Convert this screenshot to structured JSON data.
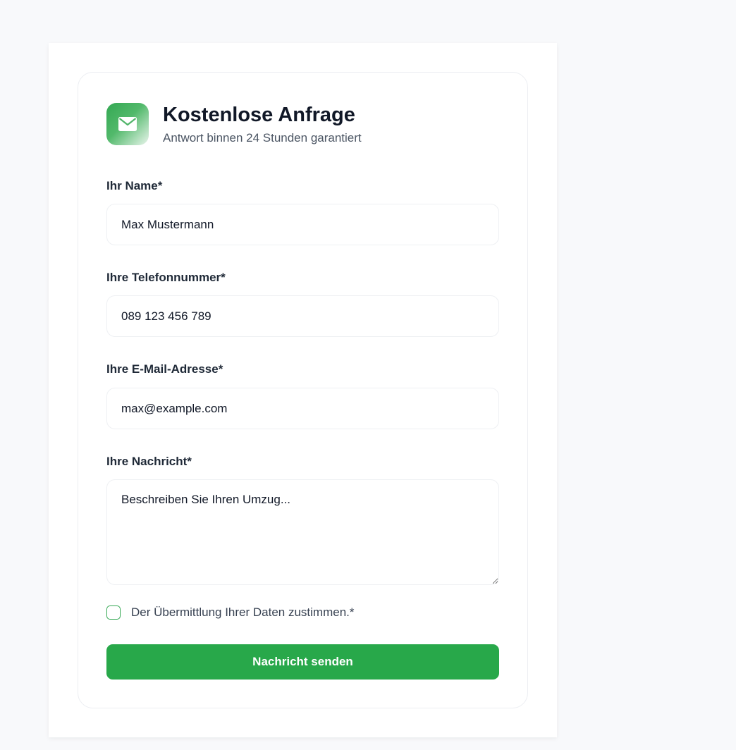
{
  "form": {
    "icon": "mail-icon",
    "title": "Kostenlose Anfrage",
    "subtitle": "Antwort binnen 24 Stunden garantiert",
    "fields": {
      "name": {
        "label": "Ihr Name*",
        "placeholder": "Max Mustermann"
      },
      "phone": {
        "label": "Ihre Telefonnummer*",
        "placeholder": "089 123 456 789"
      },
      "email": {
        "label": "Ihre E-Mail-Adresse*",
        "placeholder": "max@example.com"
      },
      "message": {
        "label": "Ihre Nachricht*",
        "placeholder": "Beschreiben Sie Ihren Umzug..."
      }
    },
    "consent_label": "Der Übermittlung Ihrer Daten zustimmen.*",
    "submit_label": "Nachricht senden"
  },
  "colors": {
    "accent": "#28a84a",
    "background": "#f8f9fb"
  }
}
